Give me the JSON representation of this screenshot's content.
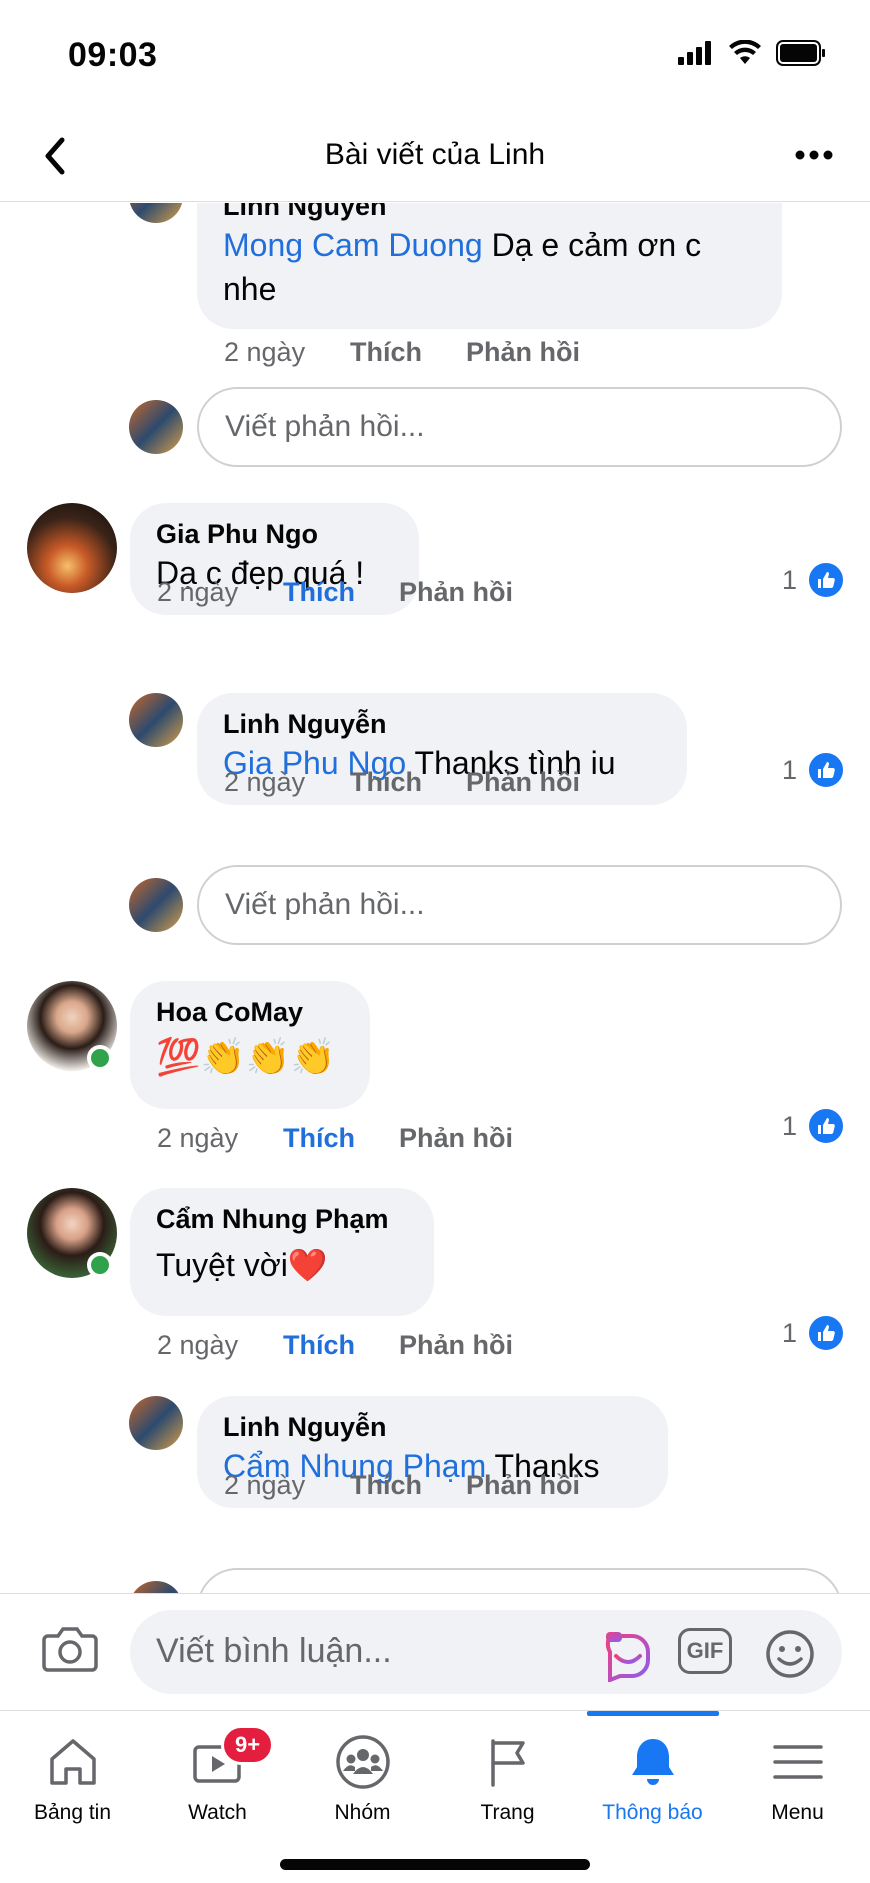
{
  "status_bar": {
    "time": "09:03"
  },
  "header": {
    "title": "Bài viết của Linh"
  },
  "comments": {
    "top_reply": {
      "name": "Linh Nguyễn",
      "mention": "Mong Cam Duong",
      "text_line1": " Dạ e cảm ơn c",
      "text_line2": "nhe",
      "time": "2 ngày",
      "like": "Thích",
      "reply": "Phản hồi"
    },
    "reply_box_1": {
      "placeholder": "Viết phản hồi..."
    },
    "c1": {
      "name": "Gia Phu Ngo",
      "text": "Dạ c đẹp quá !",
      "time": "2 ngày",
      "like": "Thích",
      "reply": "Phản hồi",
      "likes": "1"
    },
    "c1_reply": {
      "name": "Linh Nguyễn",
      "mention": "Gia Phu Ngo",
      "text": " Thanks tình iu",
      "time": "2 ngày",
      "like": "Thích",
      "reply": "Phản hồi",
      "likes": "1"
    },
    "reply_box_2": {
      "placeholder": "Viết phản hồi..."
    },
    "c2": {
      "name": "Hoa CoMay",
      "text": "💯👏👏👏",
      "time": "2 ngày",
      "like": "Thích",
      "reply": "Phản hồi",
      "likes": "1"
    },
    "c3": {
      "name": "Cẩm Nhung Phạm",
      "text": "Tuyệt vời❤️",
      "time": "2 ngày",
      "like": "Thích",
      "reply": "Phản hồi",
      "likes": "1"
    },
    "c3_reply": {
      "name": "Linh Nguyễn",
      "mention": "Cẩm Nhung Phạm",
      "text": " Thanks",
      "time": "2 ngày",
      "like": "Thích",
      "reply": "Phản hồi"
    }
  },
  "composer": {
    "placeholder": "Viết bình luận...",
    "gif_label": "GIF"
  },
  "tabbar": {
    "tabs": [
      {
        "label": "Bảng tin"
      },
      {
        "label": "Watch",
        "badge": "9+"
      },
      {
        "label": "Nhóm"
      },
      {
        "label": "Trang"
      },
      {
        "label": "Thông báo"
      },
      {
        "label": "Menu"
      }
    ]
  },
  "colors": {
    "accent": "#1877f2",
    "mention": "#216fdb",
    "badge": "#e41e3f",
    "online": "#31a24c"
  }
}
